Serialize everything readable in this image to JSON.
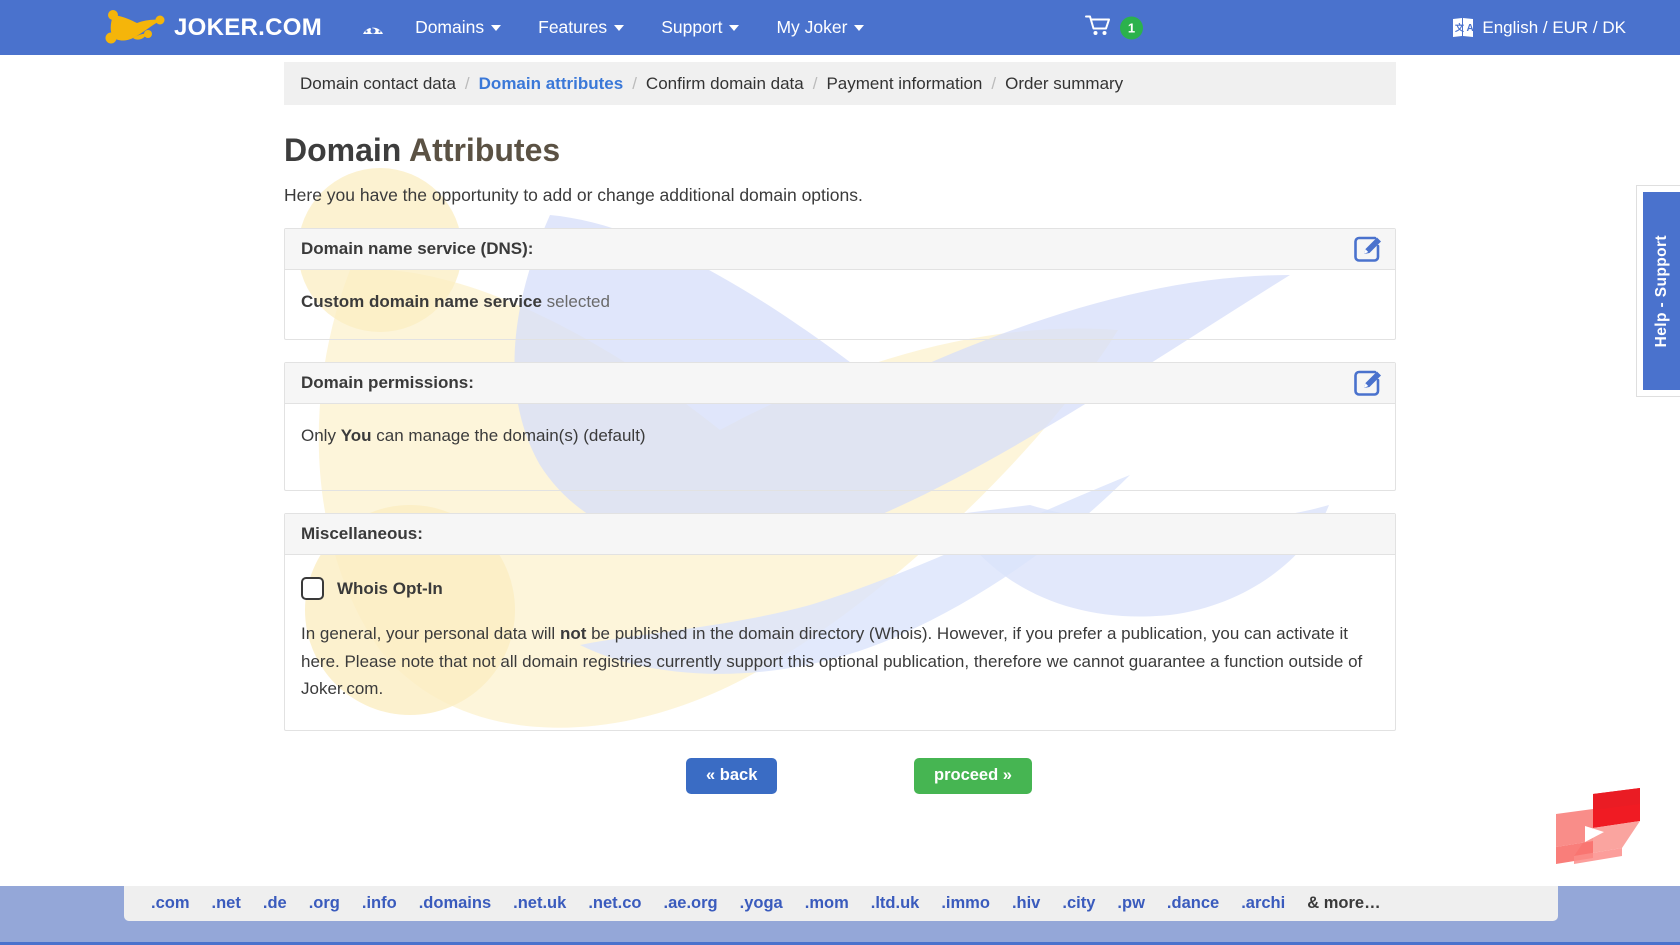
{
  "header": {
    "brand": "JOKER.COM",
    "logo_icon": "jester-hat-icon",
    "dashboard_icon": "speedometer-icon",
    "nav": [
      {
        "label": "Domains",
        "has_caret": true
      },
      {
        "label": "Features",
        "has_caret": true
      },
      {
        "label": "Support",
        "has_caret": true
      },
      {
        "label": "My Joker",
        "has_caret": true
      }
    ],
    "cart": {
      "icon": "shopping-cart-icon",
      "count": "1",
      "badge_color": "#2bb24c"
    },
    "language": {
      "icon": "language-translate-icon",
      "label": "English / EUR / DK"
    },
    "bar_color": "#4a72cd"
  },
  "breadcrumb": {
    "separator": "/",
    "steps": [
      {
        "label": "Domain contact data",
        "active": false
      },
      {
        "label": "Domain attributes",
        "active": true
      },
      {
        "label": "Confirm domain data",
        "active": false
      },
      {
        "label": "Payment information",
        "active": false
      },
      {
        "label": "Order summary",
        "active": false
      }
    ],
    "active_color": "#3a78d8"
  },
  "page": {
    "title_part1": "Domain ",
    "title_part2": "Attributes",
    "subtitle": "Here you have the opportunity to add or change additional domain options."
  },
  "panels": {
    "dns": {
      "heading": "Domain name service (DNS):",
      "edit_icon": "edit-pencil-icon",
      "value_strong": "Custom domain name service",
      "value_rest": " selected"
    },
    "permissions": {
      "heading": "Domain permissions:",
      "edit_icon": "edit-pencil-icon",
      "text_pre": "Only ",
      "text_strong": "You",
      "text_post": " can manage the domain(s) (default)"
    },
    "misc": {
      "heading": "Miscellaneous:",
      "checkbox": {
        "label": "Whois Opt-In",
        "checked": false
      },
      "description_pre": "In general, your personal data will ",
      "description_strong": "not",
      "description_post": " be published in the domain directory (Whois). However, if you prefer a publication, you can activate it here. Please note that not all domain registries currently support this optional publication, therefore we cannot guarantee a function outside of Joker.com."
    }
  },
  "buttons": {
    "back": {
      "label": "« back",
      "color": "#3a6cc4"
    },
    "proceed": {
      "label": "proceed »",
      "color": "#46b552"
    }
  },
  "help_tab": {
    "label": "Help - Support",
    "color": "#4a72cd"
  },
  "watermark": {
    "red_logo_icon": "red-brand-logo-watermark"
  },
  "footer": {
    "background": "#94a7d8",
    "tlds": [
      ".com",
      ".net",
      ".de",
      ".org",
      ".info",
      ".domains",
      ".net.uk",
      ".net.co",
      ".ae.org",
      ".yoga",
      ".mom",
      ".ltd.uk",
      ".immo",
      ".hiv",
      ".city",
      ".pw",
      ".dance",
      ".archi"
    ],
    "more_label": "& more…"
  }
}
